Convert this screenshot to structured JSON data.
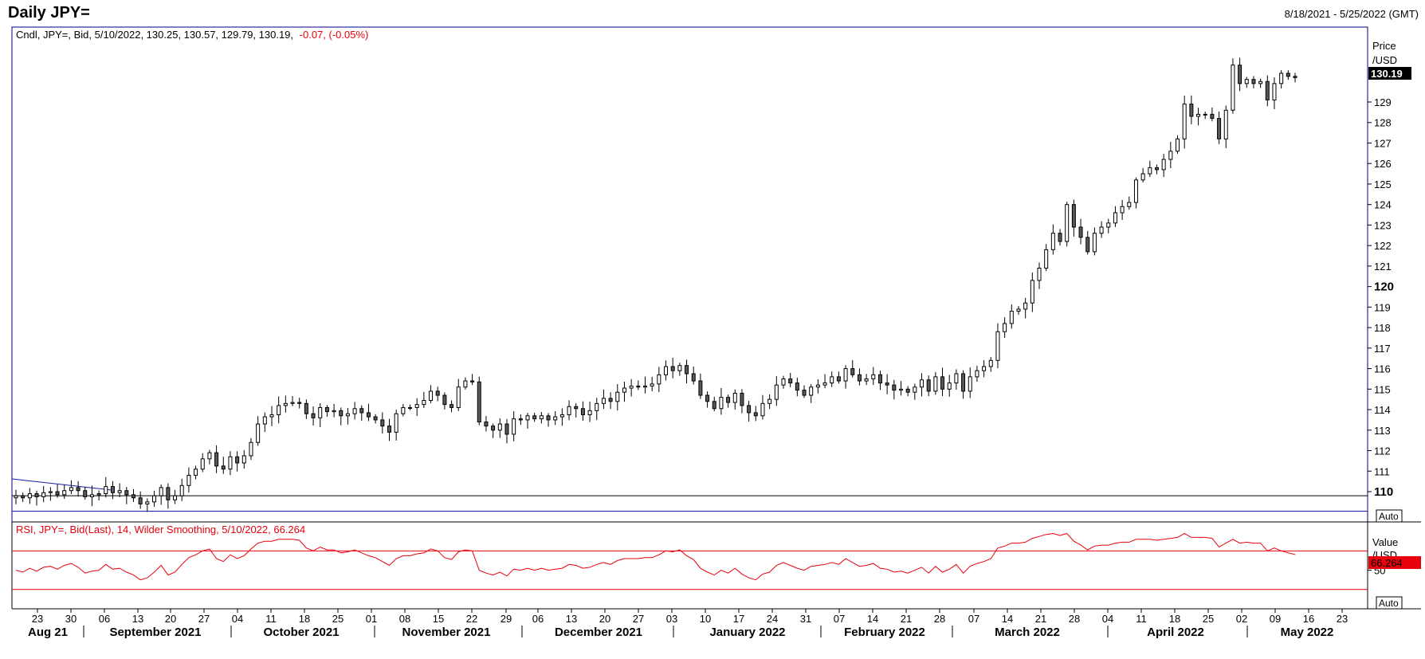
{
  "header": {
    "title": "Daily JPY=",
    "date_range": "8/18/2021 - 5/25/2022 (GMT)"
  },
  "price_panel": {
    "legend_main": "Cndl, JPY=, Bid, 5/10/2022, 130.25, 130.57, 129.79, 130.19,",
    "legend_change": "-0.07, (-0.05%)",
    "axis_title_1": "Price",
    "axis_title_2": "/USD",
    "last_price_label": "130.19",
    "auto_label": "Auto"
  },
  "rsi_panel": {
    "legend": "RSI, JPY=, Bid(Last),  14, Wilder Smoothing, 5/10/2022, 66.264",
    "axis_title_1": "Value",
    "axis_title_2": "/USD",
    "last_value_label": "66.264",
    "auto_label": "Auto"
  },
  "colors": {
    "candle_up": "#ffffff",
    "candle_down": "#595959",
    "wick": "#000000",
    "rsi_line": "#e8000d",
    "trendline": "#1a1aa6",
    "price_tag_bg": "#000000",
    "rsi_tag_bg": "#e8000d"
  },
  "chart_data": [
    {
      "type": "candlestick",
      "title": "Daily JPY=",
      "ylabel": "Price /USD",
      "ylim": [
        109.1,
        131.3
      ],
      "yticks": [
        110,
        111,
        112,
        113,
        114,
        115,
        116,
        117,
        118,
        119,
        120,
        121,
        122,
        123,
        124,
        125,
        126,
        127,
        128,
        129
      ],
      "bold_yticks": [
        110,
        120
      ],
      "xticks": [
        "23",
        "30",
        "06",
        "13",
        "20",
        "27",
        "04",
        "11",
        "18",
        "25",
        "01",
        "08",
        "15",
        "22",
        "29",
        "06",
        "13",
        "20",
        "27",
        "03",
        "10",
        "17",
        "24",
        "31",
        "07",
        "14",
        "21",
        "28",
        "07",
        "14",
        "21",
        "28",
        "04",
        "11",
        "18",
        "25",
        "02",
        "09",
        "16",
        "23"
      ],
      "months": [
        "Aug 21",
        "September 2021",
        "October 2021",
        "November 2021",
        "December 2021",
        "January 2022",
        "February 2022",
        "March 2022",
        "April 2022",
        "May 2022"
      ],
      "x_start": "2021-08-18",
      "x_end": "2022-05-25",
      "horizontal_lines": [
        109.8,
        109.05
      ],
      "close_values": [
        109.8,
        109.7,
        109.9,
        109.75,
        109.95,
        110.0,
        109.85,
        110.05,
        110.2,
        110.05,
        109.75,
        109.85,
        109.9,
        110.25,
        109.95,
        110.05,
        109.85,
        109.7,
        109.4,
        109.5,
        109.8,
        110.2,
        109.6,
        109.8,
        110.3,
        110.8,
        111.1,
        111.6,
        111.9,
        111.25,
        111.1,
        111.7,
        111.4,
        111.75,
        112.4,
        113.3,
        113.65,
        113.75,
        114.2,
        114.3,
        114.35,
        114.3,
        113.8,
        113.6,
        114.1,
        113.9,
        113.95,
        113.7,
        113.8,
        114.05,
        113.85,
        113.65,
        113.5,
        113.2,
        112.9,
        113.8,
        114.1,
        114.1,
        114.25,
        114.45,
        114.9,
        114.7,
        114.25,
        114.1,
        115.1,
        115.4,
        115.35,
        113.4,
        113.2,
        113.0,
        113.3,
        112.8,
        113.55,
        113.5,
        113.7,
        113.55,
        113.7,
        113.5,
        113.65,
        113.75,
        114.15,
        114.05,
        113.75,
        113.95,
        114.3,
        114.55,
        114.4,
        114.85,
        115.05,
        115.15,
        115.1,
        115.15,
        115.25,
        115.7,
        116.1,
        115.9,
        116.15,
        115.75,
        115.4,
        114.7,
        114.4,
        114.05,
        114.6,
        114.35,
        114.8,
        114.2,
        113.85,
        113.7,
        114.3,
        114.5,
        115.2,
        115.5,
        115.3,
        114.95,
        114.7,
        115.1,
        115.2,
        115.3,
        115.6,
        115.4,
        116.0,
        115.7,
        115.4,
        115.5,
        115.7,
        115.3,
        115.2,
        114.95,
        115.0,
        114.85,
        115.1,
        115.45,
        114.9,
        115.6,
        115.0,
        115.3,
        115.75,
        114.9,
        115.6,
        115.9,
        116.1,
        116.4,
        117.8,
        118.2,
        118.8,
        118.9,
        119.2,
        120.3,
        120.9,
        121.8,
        122.6,
        122.2,
        124.0,
        122.9,
        122.4,
        121.7,
        122.6,
        122.9,
        123.1,
        123.6,
        123.9,
        124.1,
        125.2,
        125.5,
        125.8,
        125.7,
        126.2,
        126.6,
        127.2,
        128.9,
        128.3,
        128.4,
        128.4,
        128.2,
        127.2,
        128.6,
        130.8,
        129.9,
        130.1,
        129.9,
        130.0,
        129.1,
        129.9,
        130.4,
        130.25,
        130.19
      ]
    },
    {
      "type": "line",
      "title": "RSI, JPY=, Bid(Last),  14, Wilder Smoothing, 5/10/2022, 66.264",
      "ylabel": "Value /USD",
      "ylim": [
        10,
        100
      ],
      "yticks": [
        50
      ],
      "reference_lines": [
        70,
        30
      ],
      "last_value": 66.264,
      "series": [
        {
          "name": "RSI",
          "values": [
            50,
            48,
            52,
            49,
            53,
            54,
            51,
            55,
            57,
            53,
            47,
            49,
            50,
            56,
            51,
            52,
            48,
            45,
            40,
            42,
            48,
            55,
            45,
            48,
            56,
            63,
            66,
            70,
            72,
            62,
            59,
            66,
            62,
            65,
            72,
            78,
            80,
            80,
            82,
            82,
            82,
            81,
            73,
            70,
            74,
            71,
            71,
            68,
            69,
            71,
            68,
            65,
            63,
            59,
            55,
            62,
            65,
            65,
            67,
            68,
            72,
            70,
            63,
            61,
            69,
            71,
            70,
            50,
            47,
            45,
            48,
            44,
            51,
            50,
            52,
            50,
            52,
            50,
            51,
            52,
            56,
            55,
            52,
            53,
            56,
            58,
            56,
            60,
            62,
            62,
            62,
            63,
            63,
            66,
            70,
            69,
            71,
            65,
            61,
            52,
            48,
            45,
            50,
            47,
            52,
            46,
            42,
            40,
            46,
            48,
            55,
            58,
            55,
            52,
            50,
            54,
            55,
            56,
            58,
            56,
            62,
            58,
            54,
            55,
            57,
            52,
            51,
            48,
            49,
            47,
            50,
            53,
            47,
            54,
            48,
            51,
            56,
            47,
            54,
            57,
            59,
            62,
            73,
            75,
            78,
            78,
            79,
            83,
            85,
            87,
            88,
            86,
            88,
            80,
            76,
            71,
            75,
            76,
            76,
            78,
            79,
            79,
            82,
            82,
            82,
            81,
            82,
            83,
            84,
            88,
            84,
            84,
            84,
            83,
            74,
            78,
            82,
            78,
            79,
            78,
            78,
            70,
            73,
            70,
            68,
            66.264
          ]
        }
      ]
    }
  ]
}
